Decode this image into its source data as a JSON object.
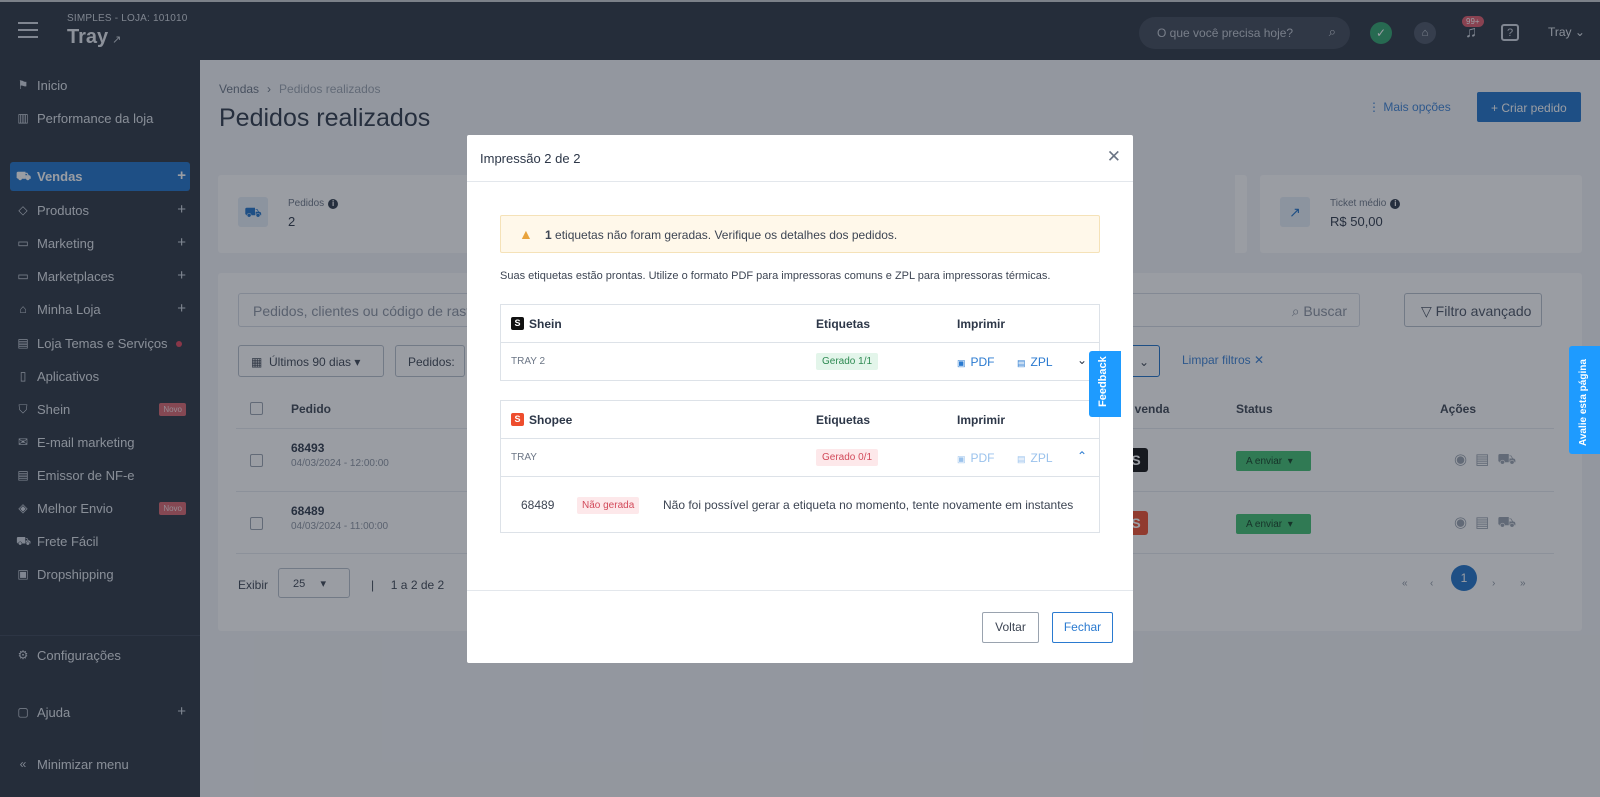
{
  "topbar": {
    "store_subtitle": "SIMPLES - LOJA: 101010",
    "store_name": "Tray",
    "search_placeholder": "O que você precisa hoje?",
    "notification_count": "99+",
    "user_name": "Tray"
  },
  "sidebar": {
    "items": [
      {
        "label": "Inicio",
        "icon": "flag-icon"
      },
      {
        "label": "Performance da loja",
        "icon": "chart-icon"
      },
      {
        "label": "Vendas",
        "icon": "cart-icon",
        "active": true,
        "expandable": true
      },
      {
        "label": "Produtos",
        "icon": "tag-icon",
        "expandable": true
      },
      {
        "label": "Marketing",
        "icon": "basket-icon",
        "expandable": true
      },
      {
        "label": "Marketplaces",
        "icon": "monitor-icon",
        "expandable": true
      },
      {
        "label": "Minha Loja",
        "icon": "home-icon",
        "expandable": true
      },
      {
        "label": "Loja Temas e Serviços",
        "icon": "layout-icon"
      },
      {
        "label": "Aplicativos",
        "icon": "phone-icon"
      },
      {
        "label": "Shein",
        "icon": "shirt-icon",
        "badge": "Novo"
      },
      {
        "label": "E-mail marketing",
        "icon": "mail-icon"
      },
      {
        "label": "Emissor de NF-e",
        "icon": "document-icon"
      },
      {
        "label": "Melhor Envio",
        "icon": "box-icon",
        "badge": "Novo"
      },
      {
        "label": "Frete Fácil",
        "icon": "truck-icon"
      },
      {
        "label": "Dropshipping",
        "icon": "bag-icon"
      }
    ],
    "settings_label": "Configurações",
    "help_label": "Ajuda",
    "minimize_label": "Minimizar menu"
  },
  "page": {
    "breadcrumb_root": "Vendas",
    "breadcrumb_current": "Pedidos realizados",
    "title": "Pedidos realizados",
    "more_options": "Mais opções",
    "create_order": "+ Criar pedido",
    "cards": [
      {
        "label": "Pedidos",
        "value": "2"
      },
      {
        "label": "Ticket médio",
        "value": "R$ 50,00"
      }
    ],
    "search_placeholder": "Pedidos, clientes ou código de rastr",
    "search_button": "Buscar",
    "advanced_filter": "Filtro avançado",
    "date_filter": "Últimos 90 dias",
    "orders_filter": "Pedidos:",
    "clear_filters": "Limpar filtros",
    "columns": {
      "pedido": "Pedido",
      "canal": "al de venda",
      "status": "Status",
      "acoes": "Ações"
    },
    "orders": [
      {
        "number": "68493",
        "date": "04/03/2024 - 12:00:00",
        "channel": "shein",
        "status": "A enviar"
      },
      {
        "number": "68489",
        "date": "04/03/2024 - 11:00:00",
        "channel": "shopee",
        "status": "A enviar"
      }
    ],
    "show_label": "Exibir",
    "per_page": "25",
    "range": "1 a 2 de 2",
    "current_page": "1"
  },
  "modal": {
    "title": "Impressão 2 de 2",
    "alert_count": "1",
    "alert_text": " etiquetas não foram geradas. Verifique os detalhes dos pedidos.",
    "description": "Suas etiquetas estão prontas. Utilize o formato PDF para impressoras comuns e ZPL para impressoras térmicas.",
    "col_labels": "Etiquetas",
    "col_print": "Imprimir",
    "groups": [
      {
        "marketplace": "Shein",
        "logo": "S",
        "logo_color": "#111111",
        "store": "TRAY 2",
        "status": "Gerado 1/1",
        "pdf": "PDF",
        "zpl": "ZPL"
      },
      {
        "marketplace": "Shopee",
        "logo": "S",
        "logo_color": "#ee4d2d",
        "store": "TRAY",
        "status": "Gerado 0/1",
        "pdf": "PDF",
        "zpl": "ZPL",
        "detail": {
          "order": "68489",
          "badge": "Não gerada",
          "message": "Não foi possível gerar a etiqueta no momento, tente novamente em instantes"
        }
      }
    ],
    "back_button": "Voltar",
    "close_button": "Fechar"
  },
  "side_tabs": {
    "feedback": "Feedback",
    "rate": "Avalie esta página"
  }
}
